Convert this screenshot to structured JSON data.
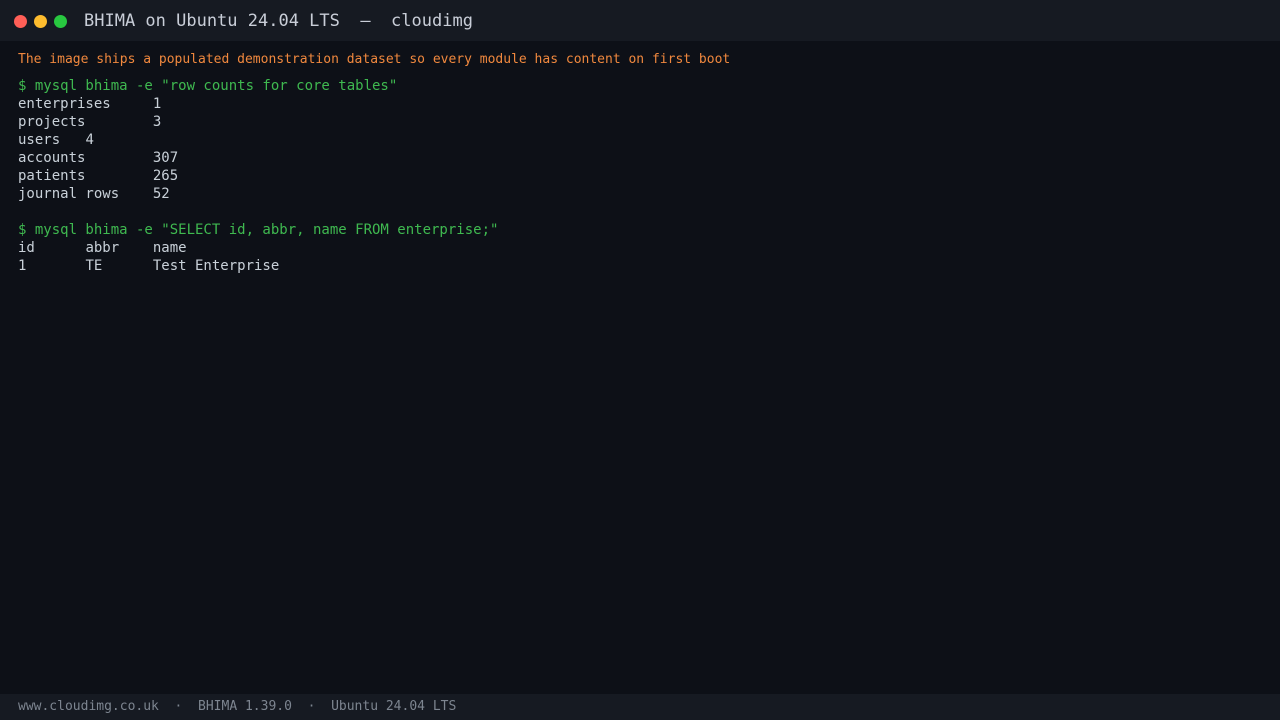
{
  "window": {
    "title": "BHIMA on Ubuntu 24.04 LTS  —  cloudimg",
    "controls": [
      "close",
      "minimize",
      "maximize"
    ]
  },
  "terminal": {
    "notice": "The image ships a populated demonstration dataset so every module has content on first boot",
    "blocks": [
      {
        "command": "$ mysql bhima -e \"row counts for core tables\"",
        "output": [
          "enterprises\t1",
          "projects\t3",
          "users\t4",
          "accounts\t307",
          "patients\t265",
          "journal rows\t52"
        ]
      },
      {
        "command": "$ mysql bhima -e \"SELECT id, abbr, name FROM enterprise;\"",
        "output": [
          "id\tabbr\tname",
          "1\tTE\tTest Enterprise"
        ]
      }
    ]
  },
  "footer": {
    "text": "www.cloudimg.co.uk  ·  BHIMA 1.39.0  ·  Ubuntu 24.04 LTS"
  },
  "colors": {
    "background": "#0d1017",
    "titlebar": "#161a22",
    "notice": "#f0883e",
    "command": "#3fb950",
    "output": "#c9d1d9",
    "footer_text": "#7d8590"
  }
}
